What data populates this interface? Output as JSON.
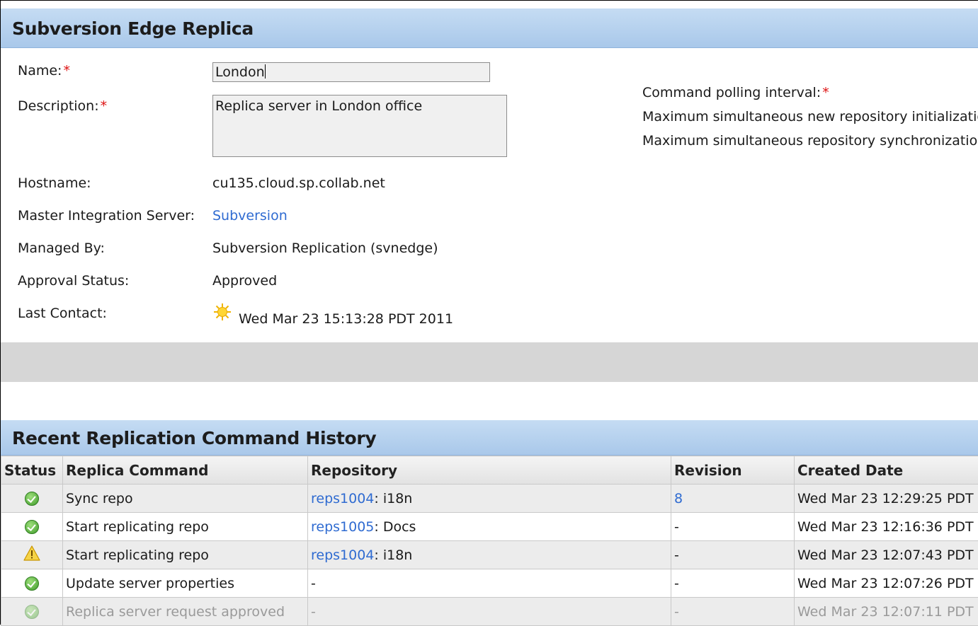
{
  "replica": {
    "title": "Subversion Edge Replica",
    "fields": {
      "name_label": "Name:",
      "name_value": "London",
      "description_label": "Description:",
      "description_value": "Replica server in London office",
      "hostname_label": "Hostname:",
      "hostname_value": "cu135.cloud.sp.collab.net",
      "master_label": "Master Integration Server:",
      "master_value": "Subversion",
      "managed_label": "Managed By:",
      "managed_value": "Subversion Replication (svnedge)",
      "approval_label": "Approval Status:",
      "approval_value": "Approved",
      "contact_label": "Last Contact:",
      "contact_value": "Wed Mar 23 15:13:28 PDT 2011",
      "required_marker": "*"
    },
    "right_fields": {
      "polling_label": "Command polling interval:",
      "max_init_label": "Maximum simultaneous new repository initializatio",
      "max_sync_label": "Maximum simultaneous repository synchronizatior"
    }
  },
  "history": {
    "title": "Recent Replication Command History",
    "columns": [
      "Status",
      "Replica Command",
      "Repository",
      "Revision",
      "Created Date"
    ],
    "rows": [
      {
        "status": "ok-icon",
        "command": "Sync repo",
        "repo_link": "reps1004",
        "repo_rest": ": i18n",
        "revision": "8",
        "revision_is_link": true,
        "created": "Wed Mar 23 12:29:25 PDT"
      },
      {
        "status": "ok-icon",
        "command": "Start replicating repo",
        "repo_link": "reps1005",
        "repo_rest": ": Docs",
        "revision": "-",
        "revision_is_link": false,
        "created": "Wed Mar 23 12:16:36 PDT"
      },
      {
        "status": "warning-icon",
        "command": "Start replicating repo",
        "repo_link": "reps1004",
        "repo_rest": ": i18n",
        "revision": "-",
        "revision_is_link": false,
        "created": "Wed Mar 23 12:07:43 PDT"
      },
      {
        "status": "ok-icon",
        "command": "Update server properties",
        "repo_link": "",
        "repo_rest": "-",
        "revision": "-",
        "revision_is_link": false,
        "created": "Wed Mar 23 12:07:26 PDT"
      },
      {
        "status": "ok-icon",
        "command": "Replica server request approved",
        "repo_link": "",
        "repo_rest": "-",
        "revision": "-",
        "revision_is_link": false,
        "created": "Wed Mar 23 12:07:11 PDT"
      }
    ]
  },
  "colors": {
    "header_blue": "#b7d2ef",
    "link": "#2f6bd1",
    "required": "#dd1111",
    "ok_green": "#4caf35",
    "warning_yellow": "#f3c317"
  }
}
